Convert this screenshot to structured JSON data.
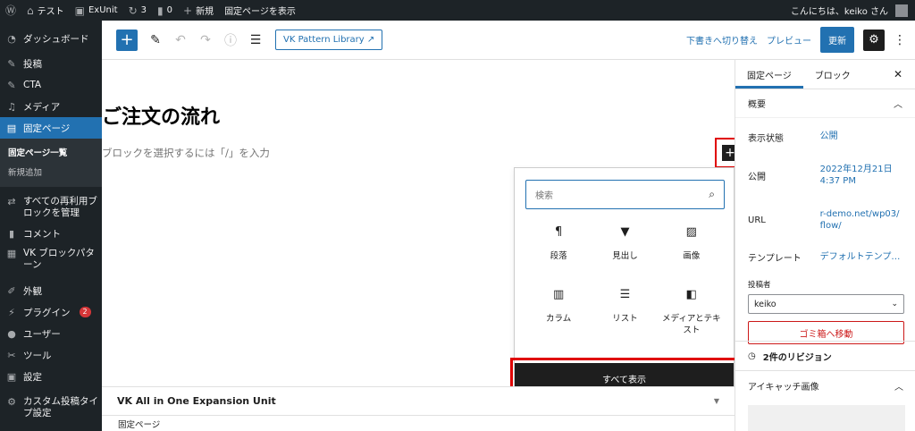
{
  "admin_bar": {
    "site_name": "テスト",
    "plugin": "ExUnit",
    "updates": "3",
    "comments": "0",
    "new_label": "新規",
    "view_page": "固定ページを表示",
    "greeting": "こんにちは、keiko さん"
  },
  "sidebar": {
    "items": [
      {
        "label": "ダッシュボード",
        "icon": "gauge-icon"
      },
      {
        "label": "投稿",
        "icon": "pin-icon"
      },
      {
        "label": "CTA",
        "icon": "pin-icon"
      },
      {
        "label": "メディア",
        "icon": "media-icon"
      },
      {
        "label": "固定ページ",
        "icon": "page-icon"
      }
    ],
    "submenu": [
      "固定ページ一覧",
      "新規追加"
    ],
    "items2": [
      {
        "label": "すべての再利用ブロックを管理",
        "icon": "reuse-icon"
      },
      {
        "label": "コメント",
        "icon": "comment-icon"
      },
      {
        "label": "VK ブロックパターン",
        "icon": "grid-icon"
      },
      {
        "label": "外観",
        "icon": "brush-icon"
      },
      {
        "label": "プラグイン",
        "icon": "plugin-icon",
        "badge": "2"
      },
      {
        "label": "ユーザー",
        "icon": "user-icon"
      },
      {
        "label": "ツール",
        "icon": "wrench-icon"
      },
      {
        "label": "設定",
        "icon": "settings-icon"
      },
      {
        "label": "カスタム投稿タイプ設定",
        "icon": "gear-icon"
      }
    ]
  },
  "header": {
    "vk_pattern": "VK Pattern Library",
    "switch_draft": "下書きへ切り替え",
    "preview": "プレビュー",
    "update": "更新"
  },
  "editor": {
    "title": "ご注文の流れ",
    "placeholder": "ブロックを選択するには「/」を入力"
  },
  "inserter": {
    "search_placeholder": "検索",
    "blocks": [
      {
        "label": "段落",
        "icon": "paragraph-icon"
      },
      {
        "label": "見出し",
        "icon": "bookmark-icon"
      },
      {
        "label": "画像",
        "icon": "image-icon"
      },
      {
        "label": "カラム",
        "icon": "columns-icon"
      },
      {
        "label": "リスト",
        "icon": "list-icon"
      },
      {
        "label": "メディアとテキスト",
        "icon": "media-text-icon"
      }
    ],
    "browse_all": "すべて表示"
  },
  "metabox": {
    "title": "VK All in One Expansion Unit"
  },
  "breadcrumb": "固定ページ",
  "panel": {
    "tab_page": "固定ページ",
    "tab_block": "ブロック",
    "summary": "概要",
    "rows": [
      {
        "key": "表示状態",
        "value": "公開"
      },
      {
        "key": "公開",
        "value": "2022年12月21日 4:37 PM"
      },
      {
        "key": "URL",
        "value": "r-demo.net/wp03/flow/"
      },
      {
        "key": "テンプレート",
        "value": "デフォルトテンプ…"
      }
    ],
    "author_label": "投稿者",
    "author_value": "keiko",
    "trash": "ゴミ箱へ移動",
    "revisions": "2件のリビジョン",
    "eyecatch": "アイキャッチ画像"
  },
  "colors": {
    "accent": "#2271b1",
    "admin_dark": "#1d2327",
    "highlight_red": "#e00000"
  }
}
